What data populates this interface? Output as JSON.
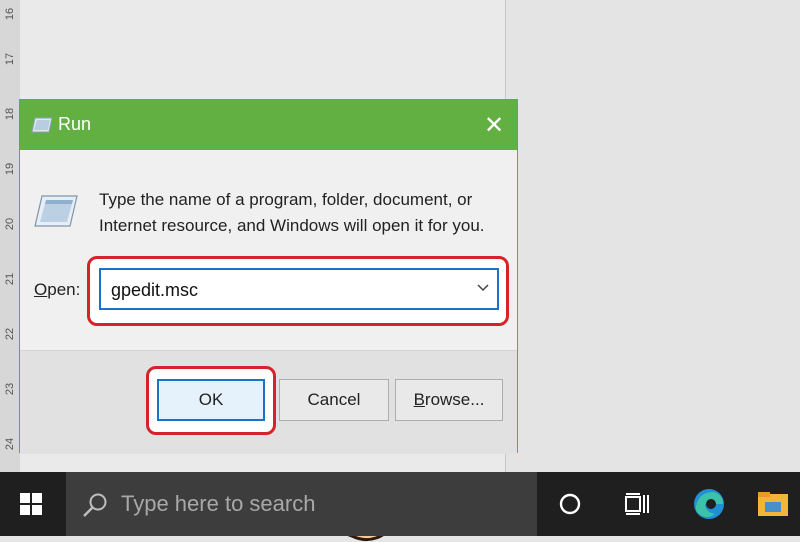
{
  "ruler": {
    "numbers": [
      "16",
      "17",
      "18",
      "19",
      "20",
      "21",
      "22",
      "23",
      "24"
    ]
  },
  "dialog": {
    "title": "Run",
    "description": "Type the name of a program, folder, document, or Internet resource, and Windows will open it for you.",
    "open_label_accel": "O",
    "open_label_rest": "pen:",
    "input_value": "gpedit.msc",
    "ok_label": "OK",
    "cancel_label": "Cancel",
    "browse_label_accel": "B",
    "browse_label_rest": "rowse...",
    "close_symbol": "✕"
  },
  "taskbar": {
    "search_placeholder": "Type here to search",
    "icons": [
      "windows-start-icon",
      "search-icon",
      "cortana-icon",
      "task-view-icon",
      "edge-icon",
      "file-explorer-icon"
    ]
  },
  "colors": {
    "titlebar": "#62b041",
    "highlight": "#d6222b",
    "focus": "#1a73c9",
    "taskbar": "#1f1f1f"
  }
}
